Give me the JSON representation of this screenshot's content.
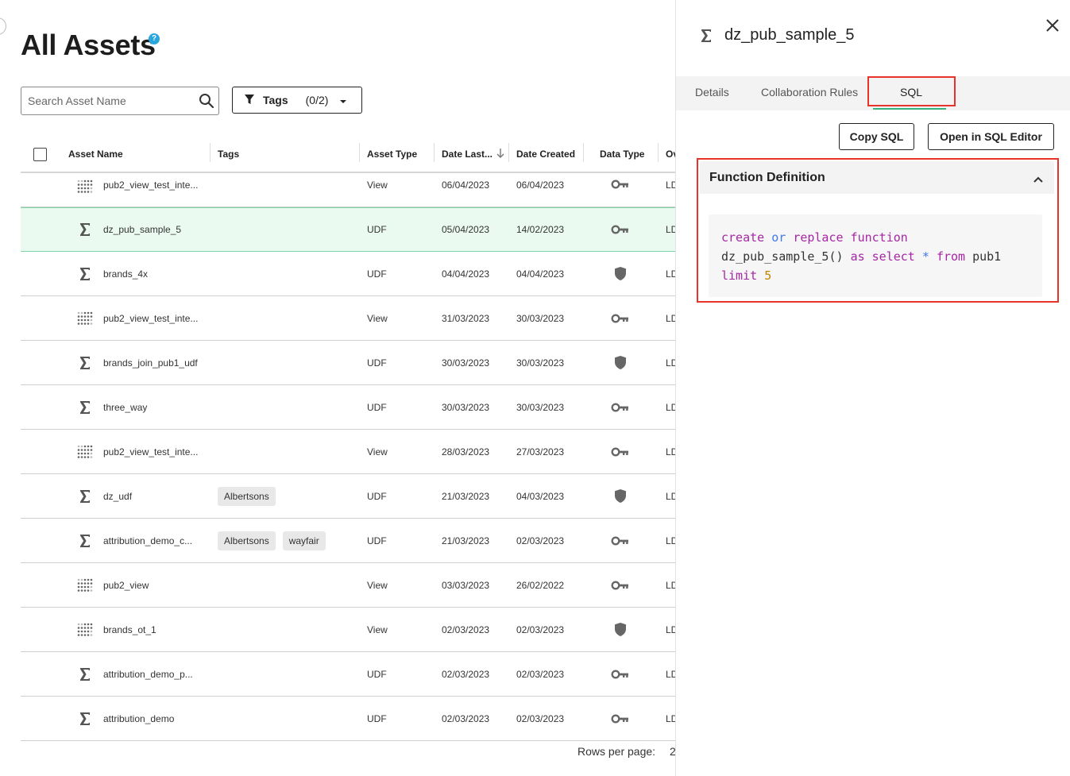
{
  "page": {
    "title": "All Assets",
    "help_glyph": "?"
  },
  "search": {
    "placeholder": "Search Asset Name"
  },
  "tags_filter": {
    "label": "Tags",
    "count": "(0/2)"
  },
  "table": {
    "columns": [
      "Asset Name",
      "Tags",
      "Asset Type",
      "Date Last...",
      "Date Created",
      "Data Type",
      "Ov"
    ],
    "rows": [
      {
        "icon": "view-grid-icon",
        "name": "pub2_view_test_inte...",
        "tags": [],
        "type": "View",
        "date_last": "06/04/2023",
        "date_created": "06/04/2023",
        "data_type": "key-icon",
        "owner": "LD"
      },
      {
        "icon": "sigma-icon",
        "name": "dz_pub_sample_5",
        "tags": [],
        "type": "UDF",
        "date_last": "05/04/2023",
        "date_created": "14/02/2023",
        "data_type": "key-icon",
        "owner": "LD",
        "selected": true
      },
      {
        "icon": "sigma-icon",
        "name": "brands_4x",
        "tags": [],
        "type": "UDF",
        "date_last": "04/04/2023",
        "date_created": "04/04/2023",
        "data_type": "shield-icon",
        "owner": "LD"
      },
      {
        "icon": "view-grid-icon",
        "name": "pub2_view_test_inte...",
        "tags": [],
        "type": "View",
        "date_last": "31/03/2023",
        "date_created": "30/03/2023",
        "data_type": "key-icon",
        "owner": "LD"
      },
      {
        "icon": "sigma-icon",
        "name": "brands_join_pub1_udf",
        "tags": [],
        "type": "UDF",
        "date_last": "30/03/2023",
        "date_created": "30/03/2023",
        "data_type": "shield-icon",
        "owner": "LD"
      },
      {
        "icon": "sigma-icon",
        "name": "three_way",
        "tags": [],
        "type": "UDF",
        "date_last": "30/03/2023",
        "date_created": "30/03/2023",
        "data_type": "key-icon",
        "owner": "LD"
      },
      {
        "icon": "view-grid-icon",
        "name": "pub2_view_test_inte...",
        "tags": [],
        "type": "View",
        "date_last": "28/03/2023",
        "date_created": "27/03/2023",
        "data_type": "key-icon",
        "owner": "LD"
      },
      {
        "icon": "sigma-icon",
        "name": "dz_udf",
        "tags": [
          "Albertsons"
        ],
        "type": "UDF",
        "date_last": "21/03/2023",
        "date_created": "04/03/2023",
        "data_type": "shield-icon",
        "owner": "LD"
      },
      {
        "icon": "sigma-icon",
        "name": "attribution_demo_c...",
        "tags": [
          "Albertsons",
          "wayfair"
        ],
        "type": "UDF",
        "date_last": "21/03/2023",
        "date_created": "02/03/2023",
        "data_type": "key-icon",
        "owner": "LD"
      },
      {
        "icon": "view-grid-icon",
        "name": "pub2_view",
        "tags": [],
        "type": "View",
        "date_last": "03/03/2023",
        "date_created": "26/02/2022",
        "data_type": "key-icon",
        "owner": "LD"
      },
      {
        "icon": "view-grid-icon",
        "name": "brands_ot_1",
        "tags": [],
        "type": "View",
        "date_last": "02/03/2023",
        "date_created": "02/03/2023",
        "data_type": "shield-icon",
        "owner": "LD"
      },
      {
        "icon": "sigma-icon",
        "name": "attribution_demo_p...",
        "tags": [],
        "type": "UDF",
        "date_last": "02/03/2023",
        "date_created": "02/03/2023",
        "data_type": "key-icon",
        "owner": "LD"
      },
      {
        "icon": "sigma-icon",
        "name": "attribution_demo",
        "tags": [],
        "type": "UDF",
        "date_last": "02/03/2023",
        "date_created": "02/03/2023",
        "data_type": "key-icon",
        "owner": "LD"
      }
    ]
  },
  "pagination": {
    "rows_per_page_label": "Rows per page:",
    "rows_per_page_value": "2"
  },
  "drawer": {
    "title": "dz_pub_sample_5",
    "tabs": [
      "Details",
      "Collaboration Rules",
      "SQL"
    ],
    "active_tab": "SQL",
    "copy_sql_label": "Copy SQL",
    "open_editor_label": "Open in SQL Editor",
    "section_title": "Function Definition",
    "sql": {
      "line1": [
        "create",
        "or",
        "replace",
        "function"
      ],
      "line2": [
        "dz_pub_sample_5()",
        "as",
        "select",
        "*",
        "from",
        "pub1"
      ],
      "line3": [
        "limit",
        "5"
      ]
    }
  },
  "colors": {
    "selected_row_bg": "#eafaf1",
    "tab_underline": "#36b37e",
    "highlight_box": "#e8332b",
    "help_icon": "#2aa6de",
    "sql_keyword": "#a626a4",
    "sql_operator": "#4078f2",
    "sql_number": "#c18401"
  }
}
